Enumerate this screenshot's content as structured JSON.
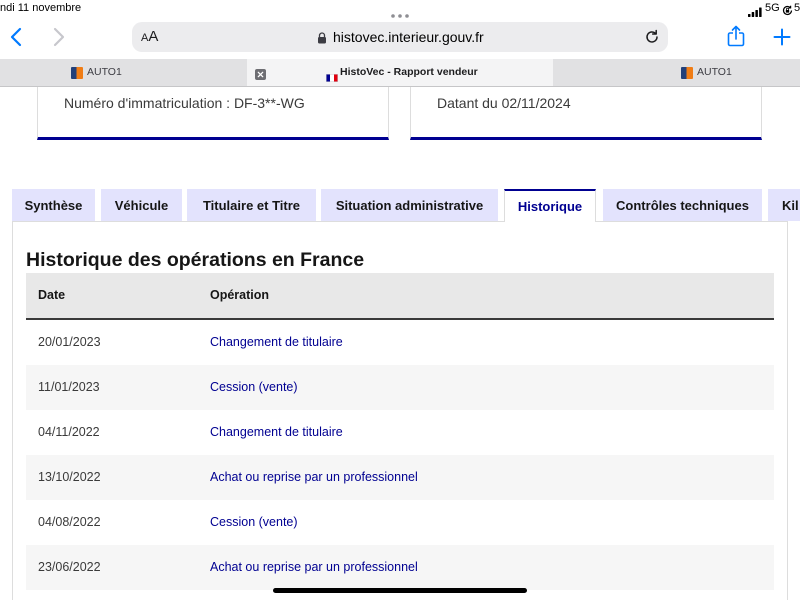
{
  "status_bar": {
    "date": "ndi 11 novembre",
    "network": "5G",
    "battery": "5"
  },
  "browser": {
    "text_size_label": "AA",
    "url": "histovec.interieur.gouv.fr",
    "tabs": [
      {
        "title": "AUTO1",
        "favicon": "auto1-favicon-icon"
      },
      {
        "title": "HistoVec - Rapport vendeur",
        "favicon": "french-flag-icon"
      },
      {
        "title": "AUTO1",
        "favicon": "auto1-favicon-icon"
      }
    ],
    "active_tab_index": 1
  },
  "report_header": {
    "registration": "Numéro d'immatriculation : DF-3**-WG",
    "report_date": "Datant du 02/11/2024"
  },
  "report_tabs": {
    "items": [
      "Synthèse",
      "Véhicule",
      "Titulaire et Titre",
      "Situation administrative",
      "Historique",
      "Contrôles techniques",
      "Kil"
    ],
    "active_index": 4
  },
  "history": {
    "title": "Historique des opérations en France",
    "columns": {
      "date": "Date",
      "operation": "Opération"
    },
    "rows": [
      {
        "date": "20/01/2023",
        "operation": "Changement de titulaire"
      },
      {
        "date": "11/01/2023",
        "operation": "Cession (vente)"
      },
      {
        "date": "04/11/2022",
        "operation": "Changement de titulaire"
      },
      {
        "date": "13/10/2022",
        "operation": "Achat ou reprise par un professionnel"
      },
      {
        "date": "04/08/2022",
        "operation": "Cession (vente)"
      },
      {
        "date": "23/06/2022",
        "operation": "Achat ou reprise par un professionnel"
      }
    ]
  },
  "icons": {
    "back": "chevron-left-icon",
    "forward": "chevron-right-icon",
    "secure": "lock-icon",
    "reload": "reload-icon",
    "share": "share-icon",
    "new_tab": "plus-icon",
    "close_tab": "close-icon"
  },
  "colors": {
    "accent": "#000091",
    "report_tab_background": "#e3e3fd",
    "safari_blue": "#007aff",
    "table_header": "#e8e8e8",
    "row_stripe": "#f6f6f6"
  }
}
